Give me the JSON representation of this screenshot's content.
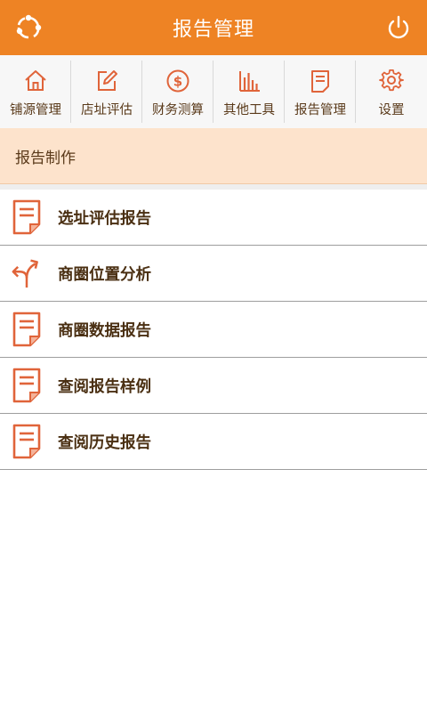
{
  "header": {
    "title": "报告管理",
    "left_icon": "refresh-icon",
    "right_icon": "power-icon"
  },
  "nav": {
    "items": [
      {
        "label": "铺源管理",
        "icon": "home-icon"
      },
      {
        "label": "店址评估",
        "icon": "edit-icon"
      },
      {
        "label": "财务测算",
        "icon": "dollar-icon"
      },
      {
        "label": "其他工具",
        "icon": "bar-chart-icon"
      },
      {
        "label": "报告管理",
        "icon": "report-icon"
      },
      {
        "label": "设置",
        "icon": "gear-icon"
      }
    ]
  },
  "section": {
    "title": "报告制作"
  },
  "list": {
    "items": [
      {
        "label": "选址评估报告",
        "icon": "document-icon"
      },
      {
        "label": "商圈位置分析",
        "icon": "fork-arrow-icon"
      },
      {
        "label": "商圈数据报告",
        "icon": "document-icon"
      },
      {
        "label": "查阅报告样例",
        "icon": "document-icon"
      },
      {
        "label": "查阅历史报告",
        "icon": "document-icon"
      }
    ]
  },
  "colors": {
    "accent": "#ee8324",
    "icon": "#e0643a",
    "section_bg": "#fde3cc",
    "text": "#4a2f12"
  }
}
